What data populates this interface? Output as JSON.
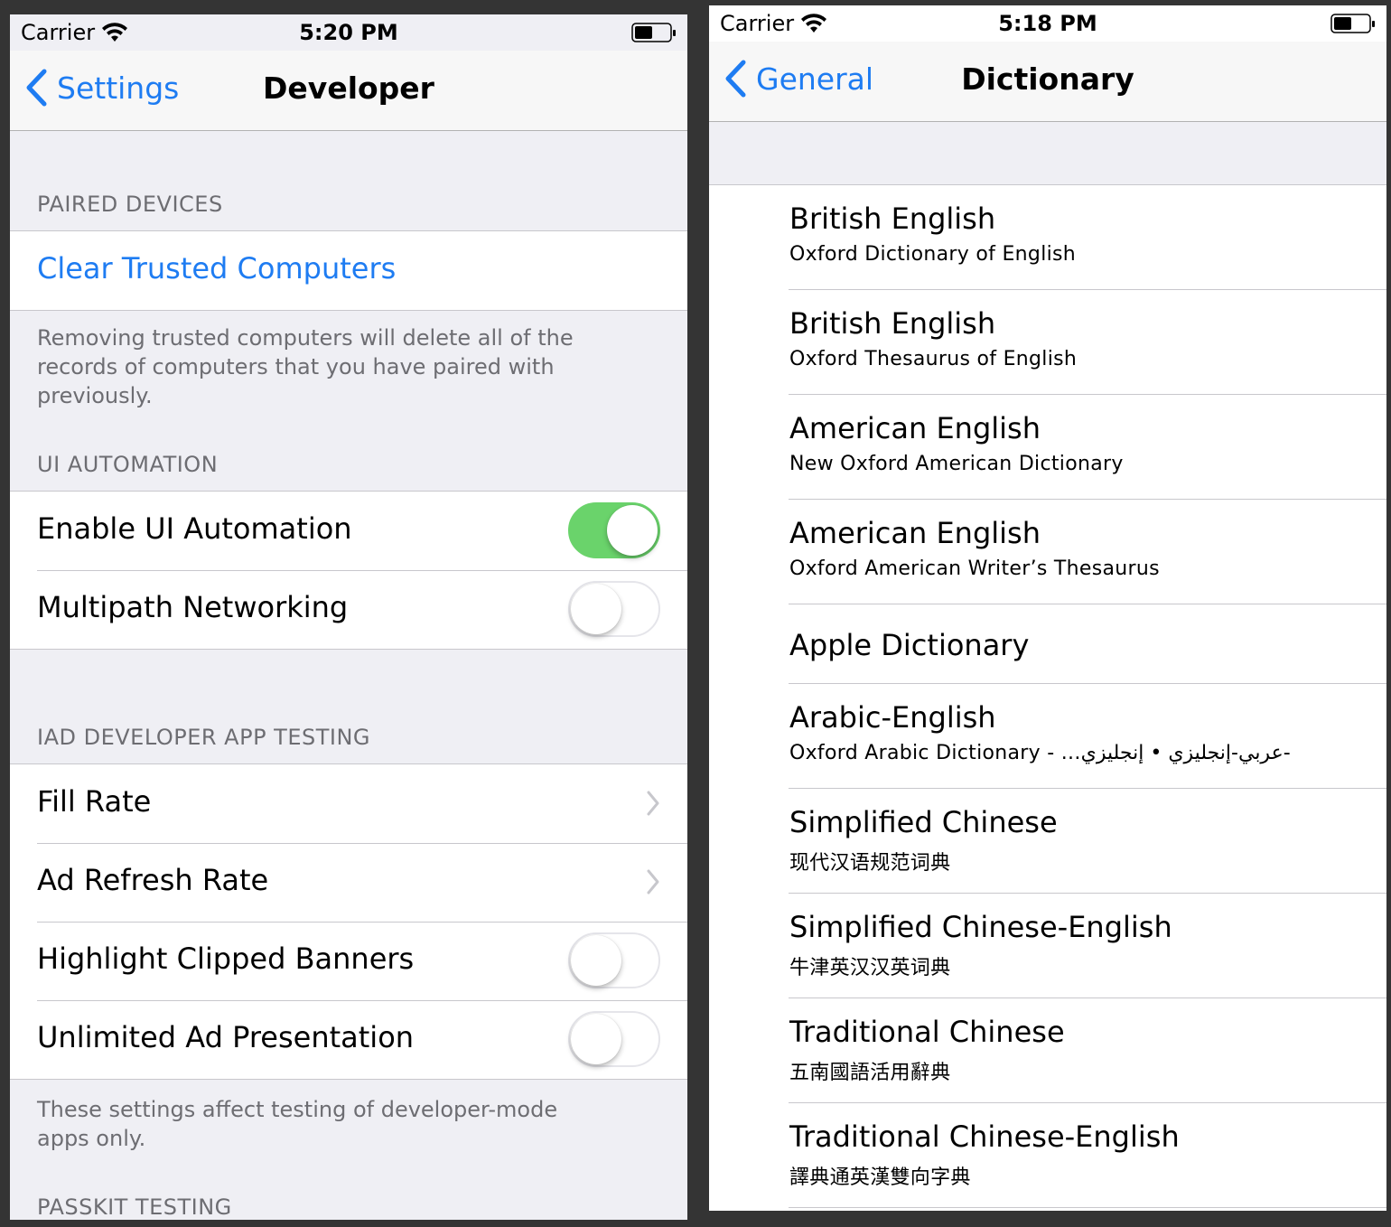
{
  "left": {
    "status": {
      "carrier": "Carrier",
      "time": "5:20 PM"
    },
    "nav": {
      "back": "Settings",
      "title": "Developer"
    },
    "paired": {
      "header": "PAIRED DEVICES",
      "action": "Clear Trusted Computers",
      "footer": "Removing trusted computers will delete all of the records of computers that you have paired with previously."
    },
    "ui_automation": {
      "header": "UI AUTOMATION",
      "rows": [
        {
          "label": "Enable UI Automation",
          "on": true
        },
        {
          "label": "Multipath Networking",
          "on": false
        }
      ]
    },
    "iad": {
      "header": "IAD DEVELOPER APP TESTING",
      "rows": [
        {
          "label": "Fill Rate"
        },
        {
          "label": "Ad Refresh Rate"
        },
        {
          "label": "Highlight Clipped Banners",
          "on": false
        },
        {
          "label": "Unlimited Ad Presentation",
          "on": false
        }
      ],
      "footer": "These settings affect testing of developer-mode apps only."
    },
    "passkit": {
      "header": "PASSKIT TESTING"
    }
  },
  "right": {
    "status": {
      "carrier": "Carrier",
      "time": "5:18 PM"
    },
    "nav": {
      "back": "General",
      "title": "Dictionary"
    },
    "items": [
      {
        "title": "British English",
        "subtitle": "Oxford Dictionary of English"
      },
      {
        "title": "British English",
        "subtitle": "Oxford Thesaurus of English"
      },
      {
        "title": "American English",
        "subtitle": "New Oxford American Dictionary"
      },
      {
        "title": "American English",
        "subtitle": "Oxford American Writer’s Thesaurus"
      },
      {
        "title": "Apple Dictionary",
        "subtitle": ""
      },
      {
        "title": "Arabic-English",
        "subtitle": "Oxford Arabic Dictionary - ...عربي-إنجليزي • إنجليزي-"
      },
      {
        "title": "Simplified Chinese",
        "subtitle": "现代汉语规范词典"
      },
      {
        "title": "Simplified Chinese-English",
        "subtitle": "牛津英汉汉英词典"
      },
      {
        "title": "Traditional Chinese",
        "subtitle": "五南國語活用辭典"
      },
      {
        "title": "Traditional Chinese-English",
        "subtitle": "譯典通英漢雙向字典"
      }
    ]
  },
  "colors": {
    "accent": "#1e7cf2",
    "toggle_on": "#6ad36b",
    "group_bg": "#efeff4",
    "section_text": "#6d6d72"
  }
}
